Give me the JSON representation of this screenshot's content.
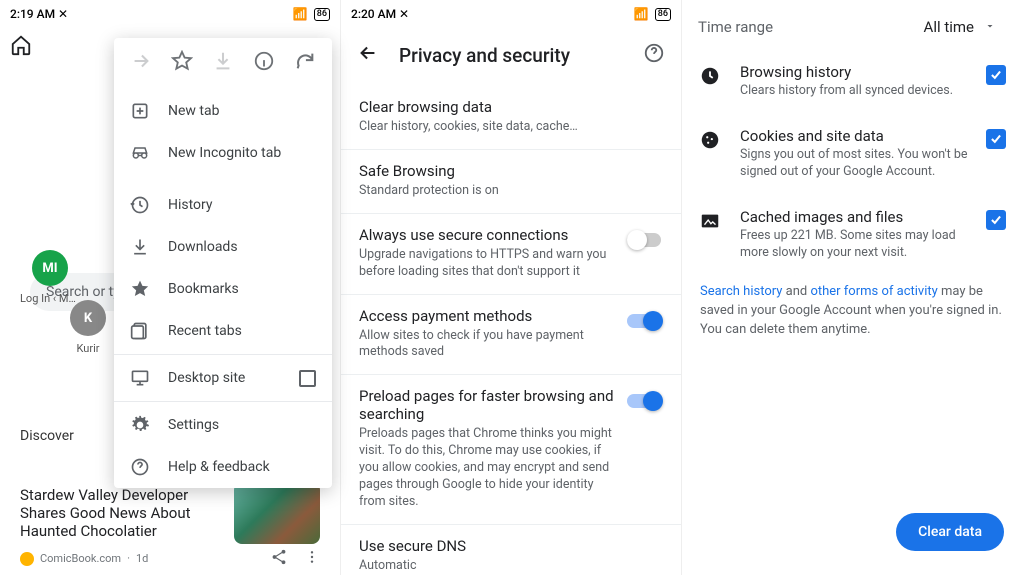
{
  "panel1": {
    "status": {
      "time": "2:19 AM",
      "battery": "86"
    },
    "search_placeholder": "Search or type",
    "shortcuts": [
      {
        "label": "Log In ‹ Mo…",
        "badge": "MI"
      },
      {
        "label": "Kurir",
        "badge": "K"
      }
    ],
    "discover": "Discover",
    "article": {
      "title": "Stardew Valley Developer Shares Good News About Haunted Chocolatier",
      "source": "ComicBook.com",
      "age": "1d"
    },
    "menu": {
      "new_tab": "New tab",
      "incognito": "New Incognito tab",
      "history": "History",
      "downloads": "Downloads",
      "bookmarks": "Bookmarks",
      "recent_tabs": "Recent tabs",
      "desktop_site": "Desktop site",
      "settings": "Settings",
      "help": "Help & feedback"
    }
  },
  "panel2": {
    "status": {
      "time": "2:20 AM",
      "battery": "86"
    },
    "title": "Privacy and security",
    "items": {
      "clear": {
        "t": "Clear browsing data",
        "s": "Clear history, cookies, site data, cache…"
      },
      "safe": {
        "t": "Safe Browsing",
        "s": "Standard protection is on"
      },
      "secure": {
        "t": "Always use secure connections",
        "s": "Upgrade navigations to HTTPS and warn you before loading sites that don't support it"
      },
      "payment": {
        "t": "Access payment methods",
        "s": "Allow sites to check if you have payment methods saved"
      },
      "preload": {
        "t": "Preload pages for faster browsing and searching",
        "s": "Preloads pages that Chrome thinks you might visit. To do this, Chrome may use cookies, if you allow cookies, and may encrypt and send pages through Google to hide your identity from sites."
      },
      "dns": {
        "t": "Use secure DNS",
        "s": "Automatic"
      }
    }
  },
  "panel3": {
    "time_range_label": "Time range",
    "time_range_value": "All time",
    "checks": {
      "history": {
        "t": "Browsing history",
        "s": "Clears history from all synced devices."
      },
      "cookies": {
        "t": "Cookies and site data",
        "s": "Signs you out of most sites. You won't be signed out of your Google Account."
      },
      "cache": {
        "t": "Cached images and files",
        "s": "Frees up 221 MB. Some sites may load more slowly on your next visit."
      }
    },
    "note": {
      "l1": "Search history",
      "mid1": " and ",
      "l2": "other forms of activity",
      "rest": " may be saved in your Google Account when you're signed in. You can delete them anytime."
    },
    "clear_button": "Clear data"
  }
}
